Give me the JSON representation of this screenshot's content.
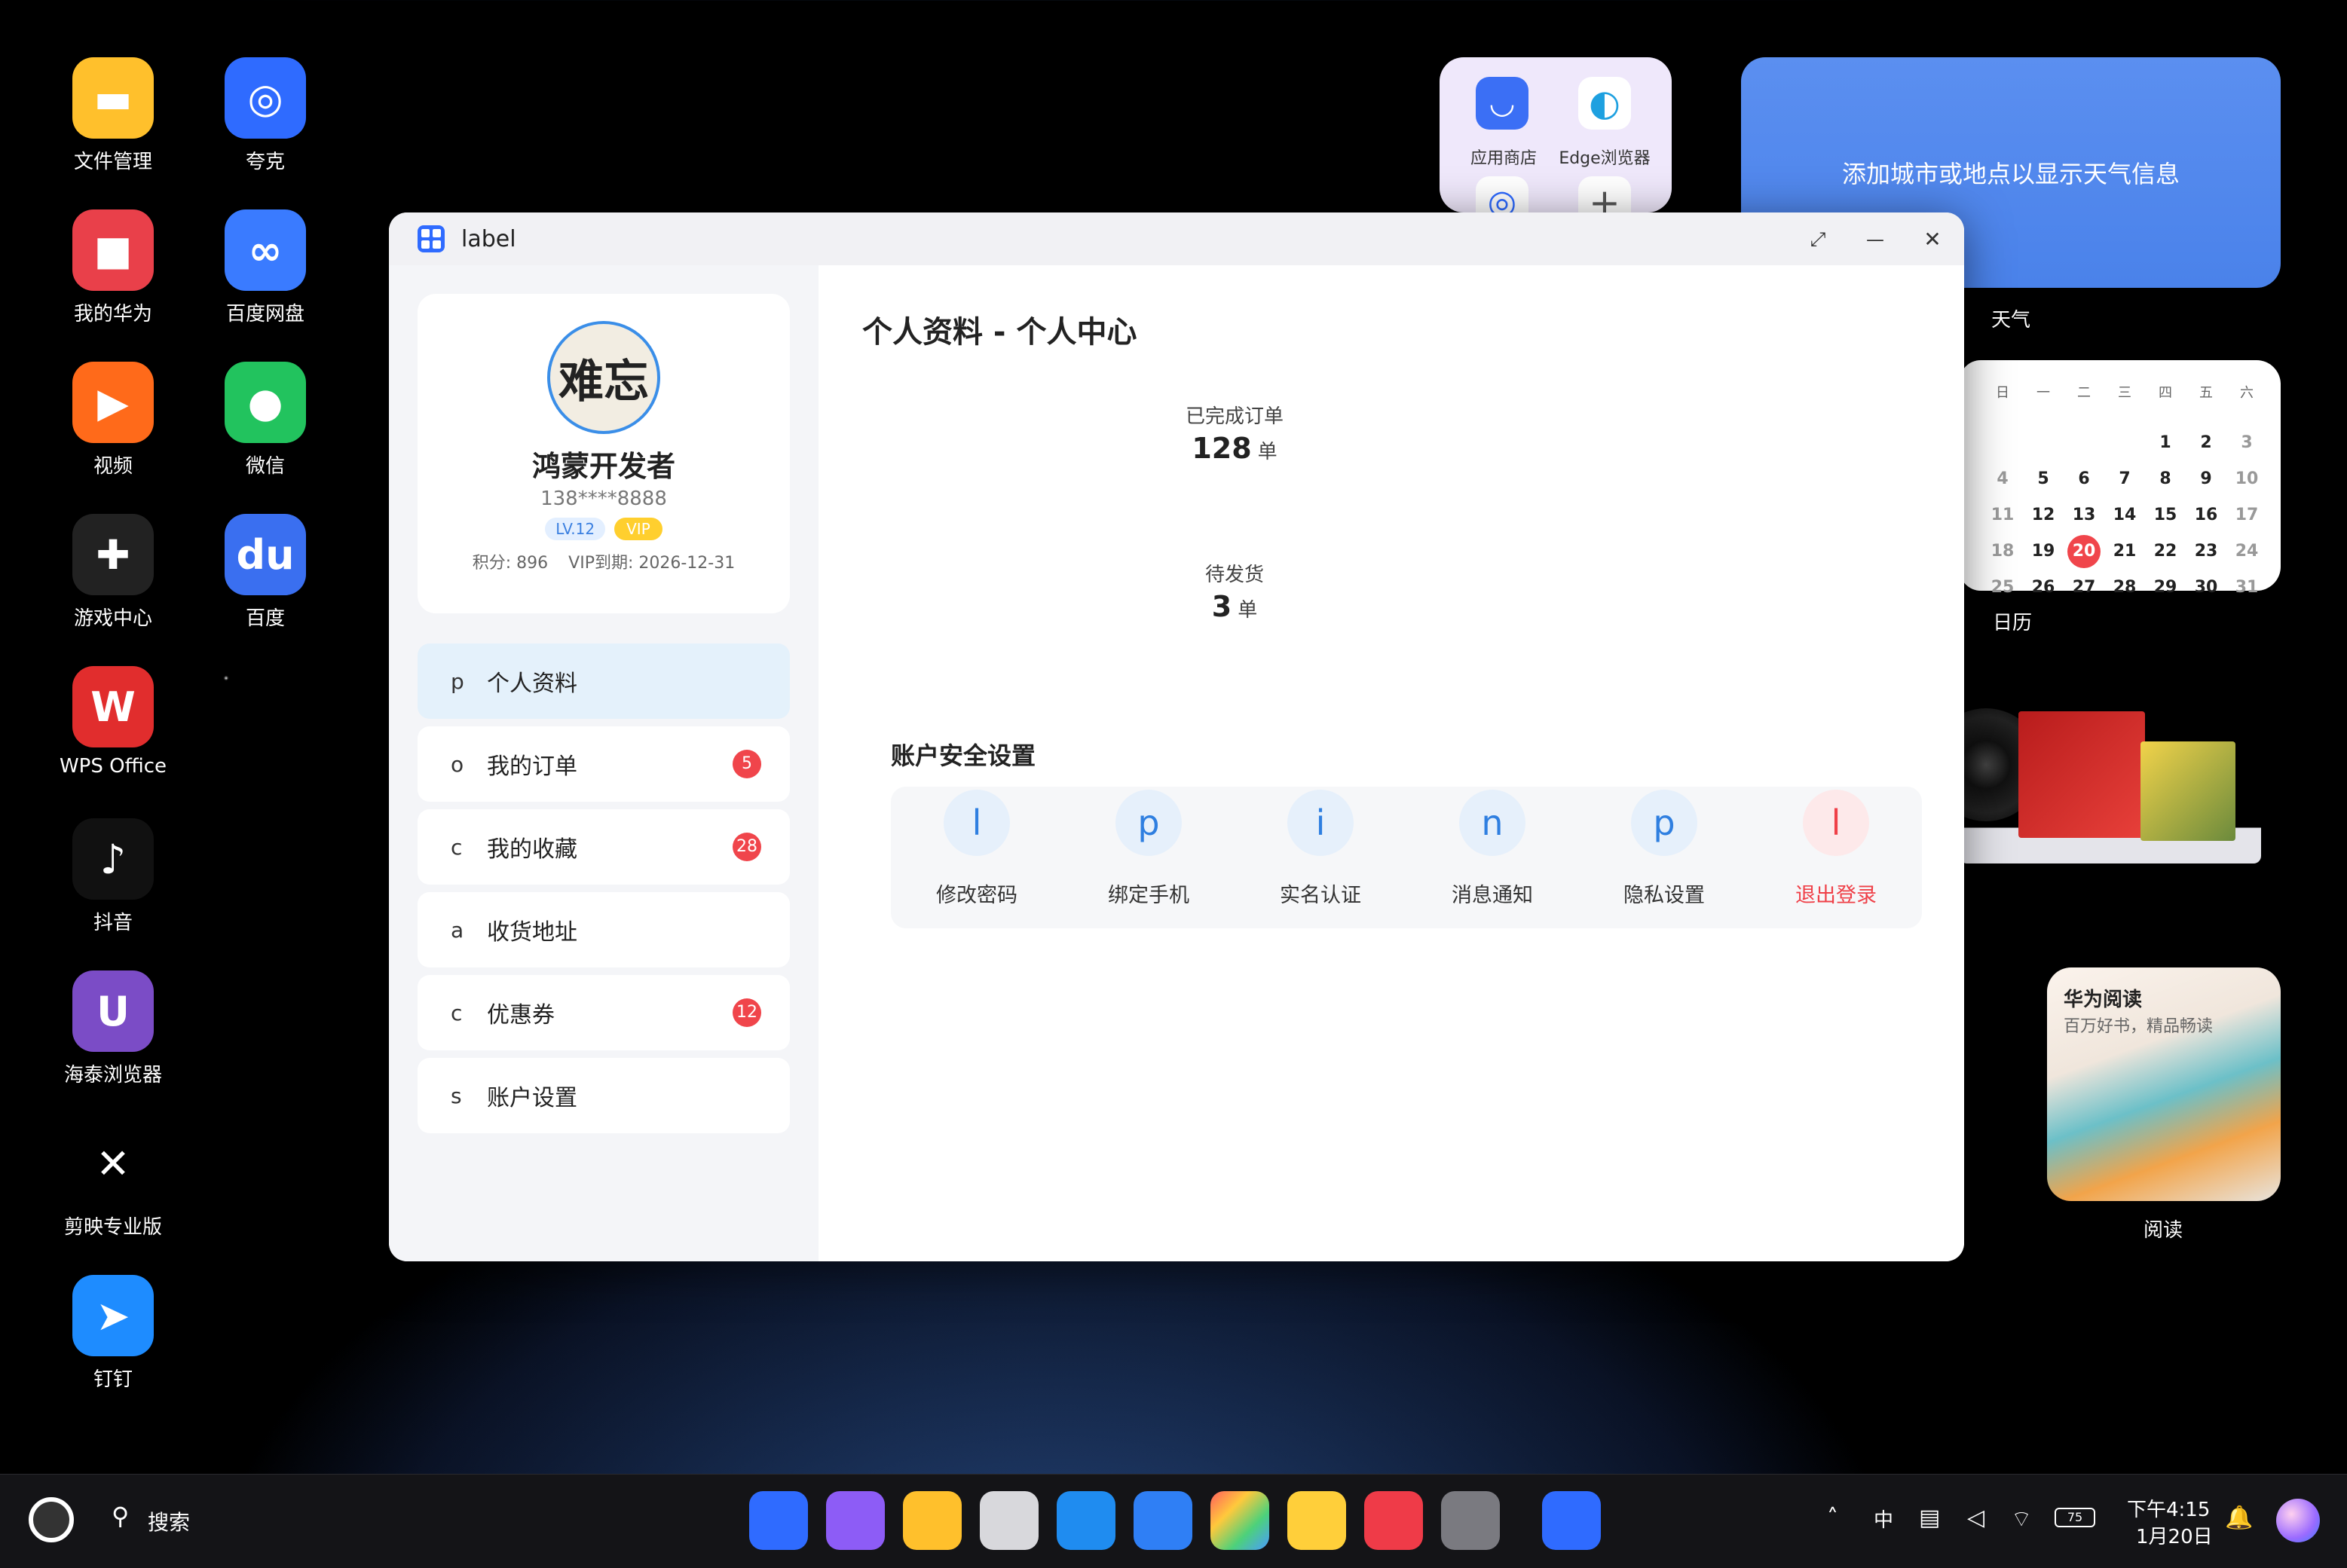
{
  "desktop": {
    "icons": [
      {
        "label": "文件管理",
        "glyph": "▬",
        "color": "#ffc02c"
      },
      {
        "label": "夸克",
        "glyph": "◎",
        "color": "#2f6bff"
      },
      {
        "label": "我的华为",
        "glyph": "■",
        "color": "#e9404a"
      },
      {
        "label": "百度网盘",
        "glyph": "∞",
        "color": "#3a7bff"
      },
      {
        "label": "视频",
        "glyph": "▶",
        "color": "#ff6a1a"
      },
      {
        "label": "微信",
        "glyph": "●",
        "color": "#22c35e"
      },
      {
        "label": "游戏中心",
        "glyph": "✚",
        "color": "#222222"
      },
      {
        "label": "百度",
        "glyph": "du",
        "color": "#3a6ff0"
      },
      {
        "label": "WPS Office",
        "glyph": "W",
        "color": "#e12d2d"
      },
      {
        "label": "抖音",
        "glyph": "♪",
        "color": "#111111"
      },
      {
        "label": "海泰浏览器",
        "glyph": "U",
        "color": "#7b4cc6"
      },
      {
        "label": "剪映专业版",
        "glyph": "✕",
        "color": "#000000"
      },
      {
        "label": "钉钉",
        "glyph": "➤",
        "color": "#1e8cff"
      }
    ]
  },
  "widgets": {
    "folder": {
      "app1": "应用商店",
      "app2": "Edge浏览器"
    },
    "weather": {
      "message": "添加城市或地点以显示天气信息",
      "label": "天气"
    },
    "calendar": {
      "label": "日历",
      "weekdays": [
        "日",
        "一",
        "二",
        "三",
        "四",
        "五",
        "六"
      ],
      "rows": [
        [
          "",
          "",
          "",
          "",
          "1",
          "2",
          "3"
        ],
        [
          "4",
          "5",
          "6",
          "7",
          "8",
          "9",
          "10"
        ],
        [
          "11",
          "12",
          "13",
          "14",
          "15",
          "16",
          "17"
        ],
        [
          "18",
          "19",
          "20",
          "21",
          "22",
          "23",
          "24"
        ],
        [
          "25",
          "26",
          "27",
          "28",
          "29",
          "30",
          "31"
        ]
      ],
      "today": "20"
    },
    "reading": {
      "title": "华为阅读",
      "subtitle": "百万好书，精品畅读",
      "label": "阅读"
    }
  },
  "window": {
    "title": "label",
    "controls": {
      "maximize": "⤢",
      "minimize": "—",
      "close": "✕"
    },
    "profile": {
      "avatar_text": "难忘",
      "name": "鸿蒙开发者",
      "phone": "138****8888",
      "level": "LV.12",
      "vip": "VIP",
      "points": "积分: 896",
      "vip_expiry": "VIP到期: 2026-12-31"
    },
    "menu": [
      {
        "icon": "p",
        "label": "个人资料",
        "badge": ""
      },
      {
        "icon": "o",
        "label": "我的订单",
        "badge": "5"
      },
      {
        "icon": "c",
        "label": "我的收藏",
        "badge": "28"
      },
      {
        "icon": "a",
        "label": "收货地址",
        "badge": ""
      },
      {
        "icon": "c",
        "label": "优惠券",
        "badge": "12"
      },
      {
        "icon": "s",
        "label": "账户设置",
        "badge": ""
      }
    ],
    "page_title": "个人资料 - 个人中心",
    "stats": [
      {
        "label": "已完成订单",
        "value": "128",
        "unit": "单"
      },
      {
        "label": "待发货",
        "value": "3",
        "unit": "单"
      }
    ],
    "security_title": "账户安全设置",
    "security_items": [
      {
        "icon": "l",
        "label": "修改密码"
      },
      {
        "icon": "p",
        "label": "绑定手机"
      },
      {
        "icon": "i",
        "label": "实名认证"
      },
      {
        "icon": "n",
        "label": "消息通知"
      },
      {
        "icon": "p",
        "label": "隐私设置"
      },
      {
        "icon": "l",
        "label": "退出登录"
      }
    ]
  },
  "taskbar": {
    "search_label": "搜索",
    "input_method": "中",
    "battery": "75",
    "time": "下午4:15",
    "date": "1月20日"
  }
}
